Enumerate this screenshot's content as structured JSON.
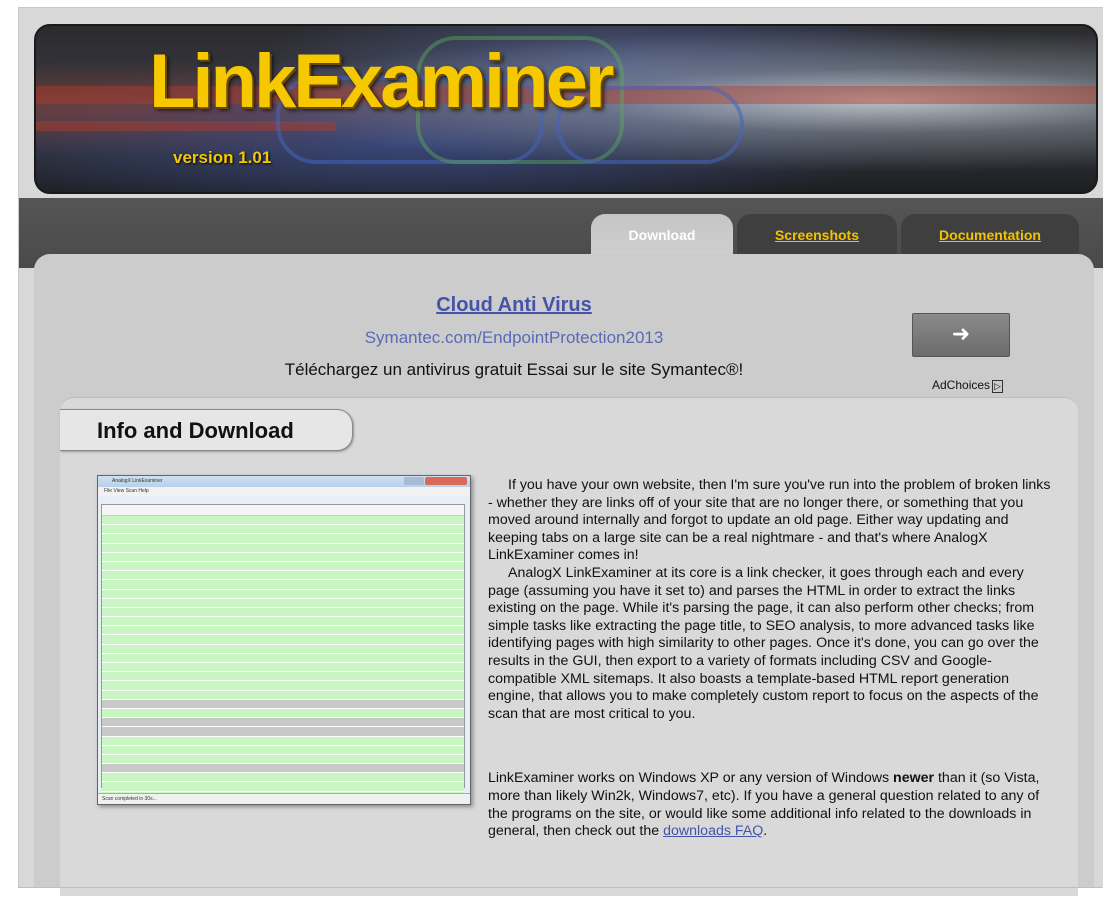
{
  "banner": {
    "logo": "LinkExaminer",
    "version": "version 1.01"
  },
  "tabs": [
    {
      "label": "Download",
      "active": true
    },
    {
      "label": "Screenshots",
      "active": false
    },
    {
      "label": "Documentation",
      "active": false
    }
  ],
  "ad": {
    "title": "Cloud Anti Virus",
    "url": "Symantec.com/EndpointProtection2013",
    "text": "Téléchargez un antivirus gratuit Essai sur le site Symantec®!",
    "button_icon": "arrow-right-icon",
    "adchoices": "AdChoices"
  },
  "section": {
    "title": "Info and Download"
  },
  "screenshot": {
    "window_title": "AnalogX LinkExaminer",
    "menu": "File  View  Scan  Help",
    "status": "Scan completed in 30s..."
  },
  "body": {
    "p1": "If you have your own website, then I'm sure you've run into the problem of broken links - whether they are links off of your site that are no longer there, or something that you moved around internally and forgot to update an old page. Either way updating and keeping tabs on a large site can be a real nightmare - and that's where AnalogX LinkExaminer comes in!",
    "p2": "AnalogX LinkExaminer at its core is a link checker, it goes through each and every page (assuming you have it set to) and parses the HTML in order to extract the links existing on the page. While it's parsing the page, it can also perform other checks; from simple tasks like extracting the page title, to SEO analysis, to more advanced tasks like identifying pages with high similarity to other pages. Once it's done, you can go over the results in the GUI, then export to a variety of formats including CSV and Google-compatible XML sitemaps. It also boasts a template-based HTML report generation engine, that allows you to make completely custom report to focus on the aspects of the scan that are most critical to you.",
    "p3_before": "LinkExaminer works on Windows XP or any version of Windows ",
    "p3_bold": "newer",
    "p3_after": " than it (so Vista, more than likely Win2k, Windows7, etc). If you have a general question related to any of the programs on the site, or would like some additional info related to the downloads in general, then check out the ",
    "faq_link": "downloads FAQ",
    "p3_end": "."
  }
}
